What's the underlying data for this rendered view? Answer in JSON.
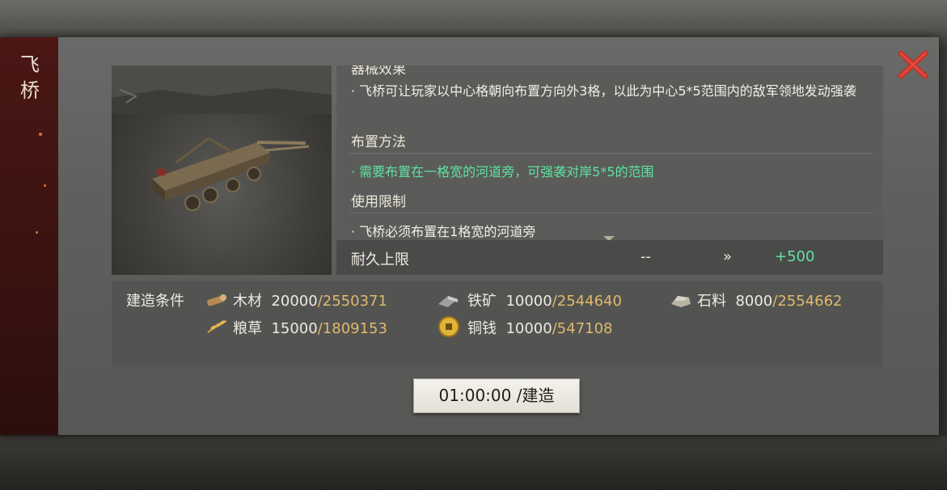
{
  "side_title_line1": "飞",
  "side_title_line2": "桥",
  "info": {
    "cut_heading": "器械效果",
    "effect_text": "· 飞桥可让玩家以中心格朝向布置方向外3格，以此为中心5*5范围内的敌军领地发动强袭",
    "placement_heading": "布置方法",
    "placement_text": "· 需要布置在一格宽的河道旁，可强袭对岸5*5的范围",
    "limit_heading": "使用限制",
    "limit_text": "· 飞桥必须布置在1格宽的河道旁"
  },
  "durability": {
    "label": "耐久上限",
    "current": "--",
    "arrow": "»",
    "next": "+500"
  },
  "conditions": {
    "label": "建造条件",
    "resources": [
      {
        "name": "木材",
        "icon": "wood-icon",
        "required": "20000",
        "owned": "/2550371"
      },
      {
        "name": "铁矿",
        "icon": "iron-ore-icon",
        "required": "10000",
        "owned": "/2544640"
      },
      {
        "name": "石料",
        "icon": "stone-icon",
        "required": "8000",
        "owned": "/2554662"
      },
      {
        "name": "粮草",
        "icon": "grain-icon",
        "required": "15000",
        "owned": "/1809153"
      },
      {
        "name": "铜钱",
        "icon": "copper-coin-icon",
        "required": "10000",
        "owned": "/547108"
      }
    ]
  },
  "build_button": "01:00:00 /建造",
  "colors": {
    "green_text": "#5fe3a0",
    "owned_amount": "#e0b96b",
    "close_red": "#c0342b",
    "side_panel": "#4a1714"
  }
}
